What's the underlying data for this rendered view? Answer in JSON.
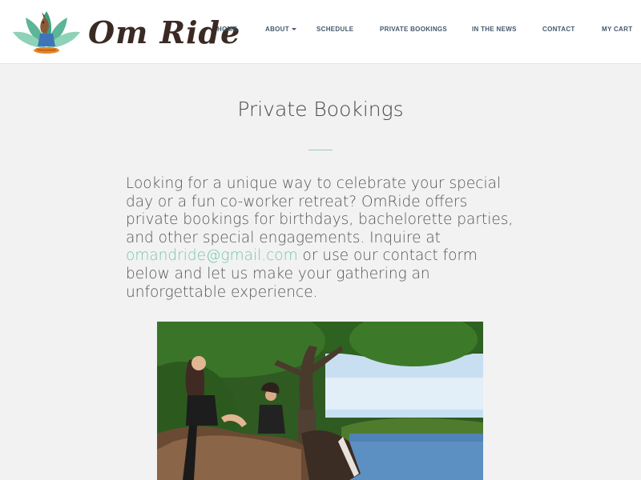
{
  "brand": {
    "name": "Om Ride",
    "logo_icon": "yoga-horse-lotus-icon",
    "colors": {
      "lotus_light": "#8ed3b8",
      "lotus_dark": "#3f9e82",
      "horse": "#8a5a35",
      "text": "#3b2a24"
    }
  },
  "nav": {
    "items": [
      {
        "label": "HOME"
      },
      {
        "label": "ABOUT",
        "has_dropdown": true
      },
      {
        "label": "SCHEDULE"
      },
      {
        "label": "PRIVATE BOOKINGS"
      },
      {
        "label": "IN THE NEWS"
      },
      {
        "label": "CONTACT"
      },
      {
        "label": "MY CART"
      }
    ]
  },
  "page": {
    "title": "Private Bookings",
    "intro_before": "Looking for a unique way to celebrate your special day or a fun co-worker retreat? OmRide offers private bookings for birthdays, bachelorette parties, and other special engagements. Inquire at ",
    "email": "omandride@gmail.com",
    "intro_after": " or use our contact form below and let us make your gathering an unforgettable experience.",
    "accent_color": "#75c7ab"
  }
}
